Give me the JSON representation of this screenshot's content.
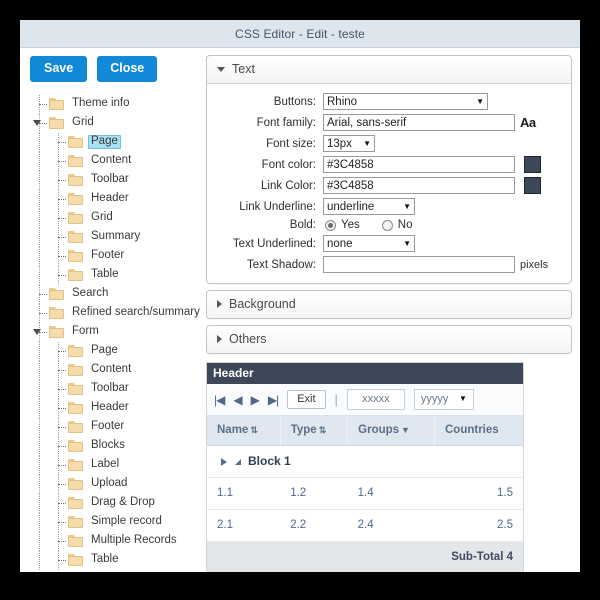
{
  "window": {
    "title": "CSS Editor - Edit - teste"
  },
  "toolbar": {
    "save_label": "Save",
    "close_label": "Close"
  },
  "tree": {
    "nodes": [
      {
        "label": "Theme info",
        "depth": 1,
        "expandable": false,
        "expanded": false,
        "selected": false
      },
      {
        "label": "Grid",
        "depth": 1,
        "expandable": true,
        "expanded": true,
        "selected": false
      },
      {
        "label": "Page",
        "depth": 2,
        "expandable": false,
        "expanded": false,
        "selected": true
      },
      {
        "label": "Content",
        "depth": 2,
        "expandable": false,
        "expanded": false,
        "selected": false
      },
      {
        "label": "Toolbar",
        "depth": 2,
        "expandable": false,
        "expanded": false,
        "selected": false
      },
      {
        "label": "Header",
        "depth": 2,
        "expandable": false,
        "expanded": false,
        "selected": false
      },
      {
        "label": "Grid",
        "depth": 2,
        "expandable": false,
        "expanded": false,
        "selected": false
      },
      {
        "label": "Summary",
        "depth": 2,
        "expandable": false,
        "expanded": false,
        "selected": false
      },
      {
        "label": "Footer",
        "depth": 2,
        "expandable": false,
        "expanded": false,
        "selected": false
      },
      {
        "label": "Table",
        "depth": 2,
        "expandable": false,
        "expanded": false,
        "selected": false
      },
      {
        "label": "Search",
        "depth": 1,
        "expandable": false,
        "expanded": false,
        "selected": false
      },
      {
        "label": "Refined search/summary",
        "depth": 1,
        "expandable": false,
        "expanded": false,
        "selected": false
      },
      {
        "label": "Form",
        "depth": 1,
        "expandable": true,
        "expanded": true,
        "selected": false
      },
      {
        "label": "Page",
        "depth": 2,
        "expandable": false,
        "expanded": false,
        "selected": false
      },
      {
        "label": "Content",
        "depth": 2,
        "expandable": false,
        "expanded": false,
        "selected": false
      },
      {
        "label": "Toolbar",
        "depth": 2,
        "expandable": false,
        "expanded": false,
        "selected": false
      },
      {
        "label": "Header",
        "depth": 2,
        "expandable": false,
        "expanded": false,
        "selected": false
      },
      {
        "label": "Footer",
        "depth": 2,
        "expandable": false,
        "expanded": false,
        "selected": false
      },
      {
        "label": "Blocks",
        "depth": 2,
        "expandable": false,
        "expanded": false,
        "selected": false
      },
      {
        "label": "Label",
        "depth": 2,
        "expandable": false,
        "expanded": false,
        "selected": false
      },
      {
        "label": "Upload",
        "depth": 2,
        "expandable": false,
        "expanded": false,
        "selected": false
      },
      {
        "label": "Drag & Drop",
        "depth": 2,
        "expandable": false,
        "expanded": false,
        "selected": false
      },
      {
        "label": "Simple record",
        "depth": 2,
        "expandable": false,
        "expanded": false,
        "selected": false
      },
      {
        "label": "Multiple Records",
        "depth": 2,
        "expandable": false,
        "expanded": false,
        "selected": false
      },
      {
        "label": "Table",
        "depth": 2,
        "expandable": false,
        "expanded": false,
        "selected": false
      }
    ]
  },
  "panels": {
    "text": {
      "title": "Text",
      "expanded": true,
      "fields": {
        "buttons_label": "Buttons:",
        "buttons_value": "Rhino",
        "font_family_label": "Font family:",
        "font_family_value": "Arial, sans-serif",
        "font_family_icon": "Aa",
        "font_size_label": "Font size:",
        "font_size_value": "13px",
        "font_color_label": "Font color:",
        "font_color_value": "#3C4858",
        "link_color_label": "Link Color:",
        "link_color_value": "#3C4858",
        "link_underline_label": "Link Underline:",
        "link_underline_value": "underline",
        "bold_label": "Bold:",
        "bold_yes": "Yes",
        "bold_no": "No",
        "bold_selected": "Yes",
        "text_underlined_label": "Text Underlined:",
        "text_underlined_value": "none",
        "text_shadow_label": "Text Shadow:",
        "text_shadow_value": "",
        "text_shadow_unit": "pixels"
      }
    },
    "background": {
      "title": "Background",
      "expanded": false
    },
    "others": {
      "title": "Others",
      "expanded": false
    }
  },
  "preview": {
    "header_title": "Header",
    "toolbar": {
      "first_label": "|◀",
      "prev_label": "◀",
      "next_label": "▶",
      "last_label": "▶|",
      "exit_label": "Exit",
      "separator": "|",
      "field_value": "xxxxx",
      "select_value": "yyyyy"
    },
    "columns": [
      {
        "label": "Name",
        "sort": "both"
      },
      {
        "label": "Type",
        "sort": "both"
      },
      {
        "label": "Groups",
        "sort": "down"
      },
      {
        "label": "Countries",
        "sort": "none"
      }
    ],
    "group_row": {
      "label": "Block 1"
    },
    "rows": [
      [
        "1.1",
        "1.2",
        "1.4",
        "1.5"
      ],
      [
        "2.1",
        "2.2",
        "2.4",
        "2.5"
      ]
    ],
    "subtotal_label": "Sub-Total 4"
  },
  "colors": {
    "accent_blue": "#1189d6",
    "header_dark": "#3C4858",
    "titlebar": "#dde5ed",
    "selection": "#a9e0f5"
  }
}
